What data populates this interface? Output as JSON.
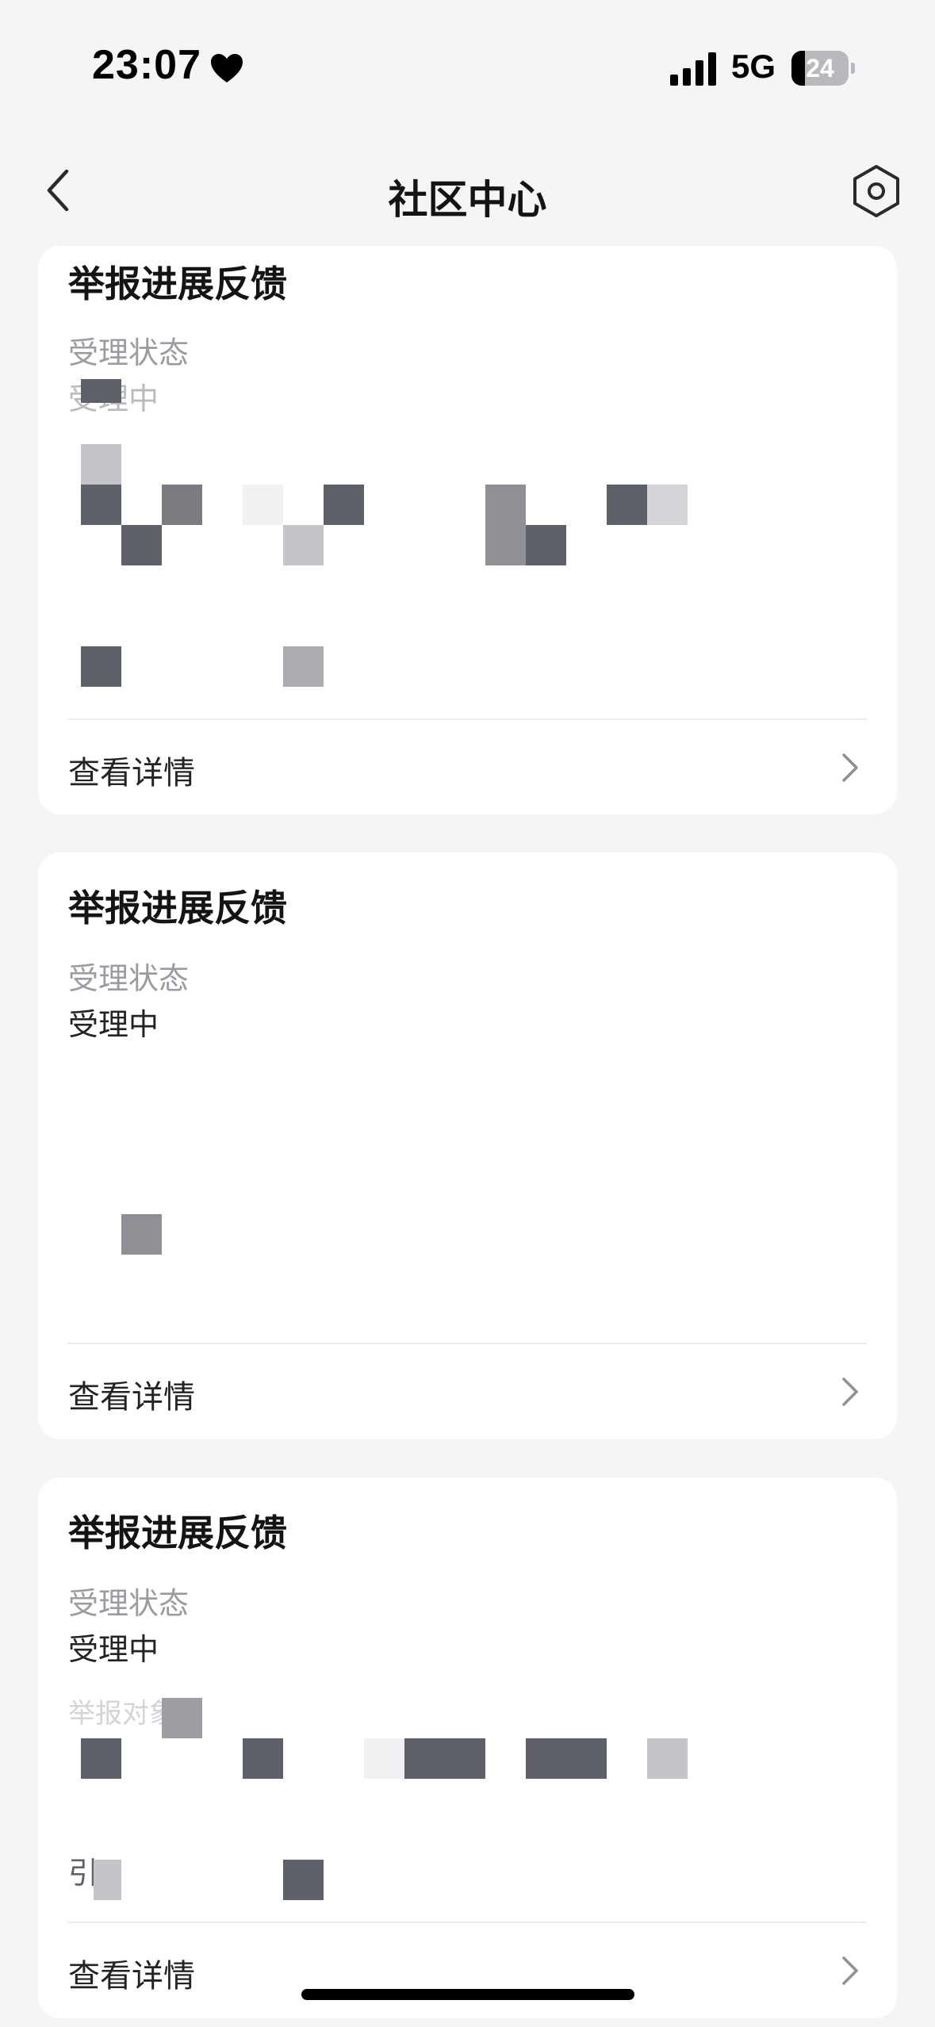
{
  "status_bar": {
    "time": "23:07",
    "network": "5G",
    "battery_level": "24",
    "battery_fraction": 0.24,
    "icons": [
      "heart-icon",
      "signal-icon",
      "battery-icon"
    ]
  },
  "nav": {
    "title": "社区中心",
    "back_icon": "chevron-left-icon",
    "settings_icon": "hexagon-settings-icon"
  },
  "colors": {
    "background": "#f4f5f7",
    "card": "#ffffff",
    "title": "#141414",
    "label": "#9a9ca2",
    "divider": "#ececee",
    "mosaic_dark": "#5f6168",
    "mosaic_mid": "#8e9096",
    "mosaic_light": "#c4c5c9"
  },
  "cards": [
    {
      "title": "举报进展反馈",
      "status_label": "受理状态",
      "status_value": "受理中",
      "detail_label": "查看详情"
    },
    {
      "title": "举报进展反馈",
      "status_label": "受理状态",
      "status_value": "受理中",
      "detail_label": "查看详情"
    },
    {
      "title": "举报进展反馈",
      "status_label": "受理状态",
      "status_value": "受理中",
      "obscured_label": "举报对象",
      "obscured_prefix": "引",
      "detail_label": "查看详情"
    }
  ]
}
